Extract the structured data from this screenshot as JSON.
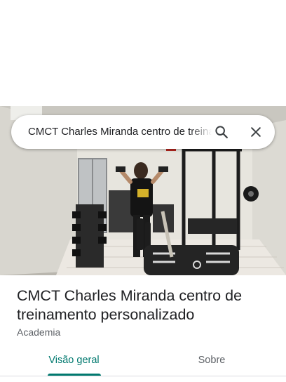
{
  "search": {
    "query": "CMCT Charles Miranda centro de treinamento personalizado"
  },
  "place": {
    "name": "CMCT Charles Miranda centro de treinamento personalizado",
    "category": "Academia"
  },
  "tabs": [
    {
      "label": "Visão geral",
      "selected": true
    },
    {
      "label": "Sobre",
      "selected": false
    }
  ],
  "icons": {
    "search": "search-icon",
    "close": "close-icon"
  },
  "colors": {
    "accent": "#01796f",
    "title": "#202124",
    "secondary": "#5f6368"
  }
}
